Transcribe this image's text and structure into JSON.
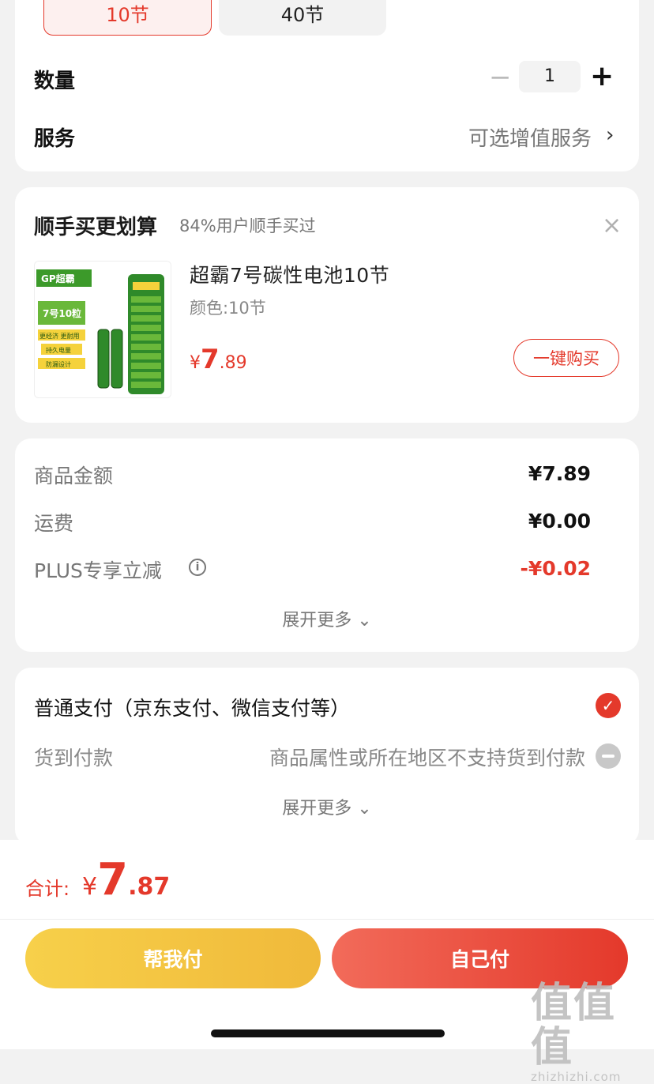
{
  "variants": [
    {
      "label": "10节",
      "selected": true
    },
    {
      "label": "40节",
      "selected": false
    }
  ],
  "quantity": {
    "label": "数量",
    "value": "1",
    "minus_icon": "minus-icon",
    "plus_icon": "plus-icon"
  },
  "service": {
    "label": "服务",
    "value": "可选增值服务",
    "chevron": "›"
  },
  "upsell": {
    "title": "顺手买更划算",
    "subtitle": "84%用户顺手买过",
    "close_icon": "×",
    "product": {
      "name": "超霸7号碳性电池10节",
      "color": "颜色:10节",
      "price_symbol": "¥",
      "price_int": "7",
      "price_dec": ".89",
      "buy_label": "一键购买",
      "image_text": {
        "brand": "GP超霸",
        "count": "7号10粒",
        "tags": [
          "更经济 更耐用",
          "持久电量",
          "防漏设计"
        ]
      }
    }
  },
  "amounts": [
    {
      "label": "商品金额",
      "value": "¥7.89",
      "color": "#111111"
    },
    {
      "label": "运费",
      "value": "¥0.00",
      "color": "#111111"
    },
    {
      "label": "PLUS专享立减",
      "value": "-¥0.02",
      "color": "#e4392b",
      "info_icon": "i"
    }
  ],
  "expand_more": "展开更多 ⌄",
  "payment": {
    "option1": "普通支付（京东支付、微信支付等）",
    "option1_checked": true,
    "option2": "货到付款",
    "option2_note": "商品属性或所在地区不支持货到付款",
    "expand_more": "展开更多 ⌄"
  },
  "footer": {
    "total_label": "合计:",
    "total_symbol": "¥",
    "total_int": "7",
    "total_dec": ".87",
    "help_pay": "帮我付",
    "self_pay": "自己付"
  },
  "watermark": {
    "big": "值值值",
    "small": "zhizhizhi.com"
  },
  "colors": {
    "accent": "#e4392b",
    "help_pay": "#f0c040"
  }
}
